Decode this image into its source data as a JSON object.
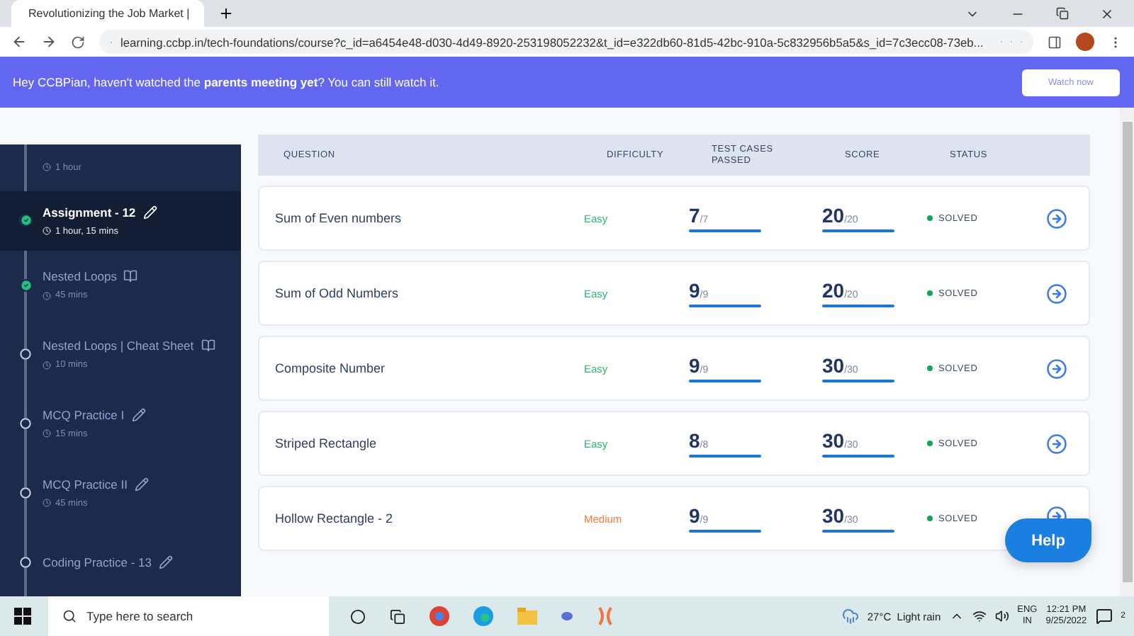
{
  "browser": {
    "tab_title": "Revolutionizing the Job Market |",
    "url": "learning.ccbp.in/tech-foundations/course?c_id=a6454e48-d030-4d49-8920-253198052232&t_id=e322db60-81d5-42bc-910a-5c832956b5a5&s_id=7c3ecc08-73eb..."
  },
  "banner": {
    "text": "Hey CCBPian, haven't watched the **parents meeting yet**? You can still watch it.",
    "button": "Watch now"
  },
  "sidebar": {
    "items": [
      {
        "kind": "partial",
        "duration": "1 hour"
      },
      {
        "kind": "assignment",
        "title": "Assignment - 12",
        "duration": "1 hour, 15 mins",
        "completed": true,
        "selected": true
      },
      {
        "kind": "reading",
        "title": "Nested Loops",
        "duration": "45 mins",
        "completed": true,
        "selected": false
      },
      {
        "kind": "reading",
        "title": "Nested Loops | Cheat Sheet",
        "duration": "10 mins",
        "completed": false,
        "selected": false
      },
      {
        "kind": "assignment",
        "title": "MCQ Practice I",
        "duration": "15 mins",
        "completed": false,
        "selected": false
      },
      {
        "kind": "assignment",
        "title": "MCQ Practice II",
        "duration": "45 mins",
        "completed": false,
        "selected": false
      },
      {
        "kind": "assignment",
        "title": "Coding Practice - 13",
        "completed": false,
        "selected": false
      }
    ]
  },
  "table": {
    "columns": [
      "QUESTION",
      "DIFFICULTY",
      "TEST CASES PASSED",
      "SCORE",
      "STATUS"
    ],
    "rows": [
      {
        "kind": "easy",
        "question": "Sum of Even numbers",
        "difficulty": "Easy",
        "tests": {
          "value": "7",
          "total": "/7",
          "level": 1
        },
        "score": {
          "value": "20",
          "total": "/20",
          "level": 1
        },
        "status": "SOLVED"
      },
      {
        "kind": "easy",
        "question": "Sum of Odd Numbers",
        "difficulty": "Easy",
        "tests": {
          "value": "9",
          "total": "/9",
          "level": 1
        },
        "score": {
          "value": "20",
          "total": "/20",
          "level": 1
        },
        "status": "SOLVED"
      },
      {
        "kind": "easy",
        "question": "Composite Number",
        "difficulty": "Easy",
        "tests": {
          "value": "9",
          "total": "/9",
          "level": 1
        },
        "score": {
          "value": "30",
          "total": "/30",
          "level": 1
        },
        "status": "SOLVED"
      },
      {
        "kind": "easy",
        "question": "Striped Rectangle",
        "difficulty": "Easy",
        "tests": {
          "value": "8",
          "total": "/8",
          "level": 1
        },
        "score": {
          "value": "30",
          "total": "/30",
          "level": 1
        },
        "status": "SOLVED"
      },
      {
        "kind": "medium",
        "question": "Hollow Rectangle - 2",
        "difficulty": "Medium",
        "tests": {
          "value": "9",
          "total": "/9",
          "level": 1
        },
        "score": {
          "value": "30",
          "total": "/30",
          "level": 1
        },
        "status": "SOLVED"
      }
    ]
  },
  "help_button": "Help",
  "taskbar": {
    "search_placeholder": "Type here to search",
    "weather": "27°C  Light rain",
    "lang": "ENG",
    "region": "IN",
    "time": "12:21 PM",
    "date": "9/25/2022",
    "notifications": "2"
  }
}
